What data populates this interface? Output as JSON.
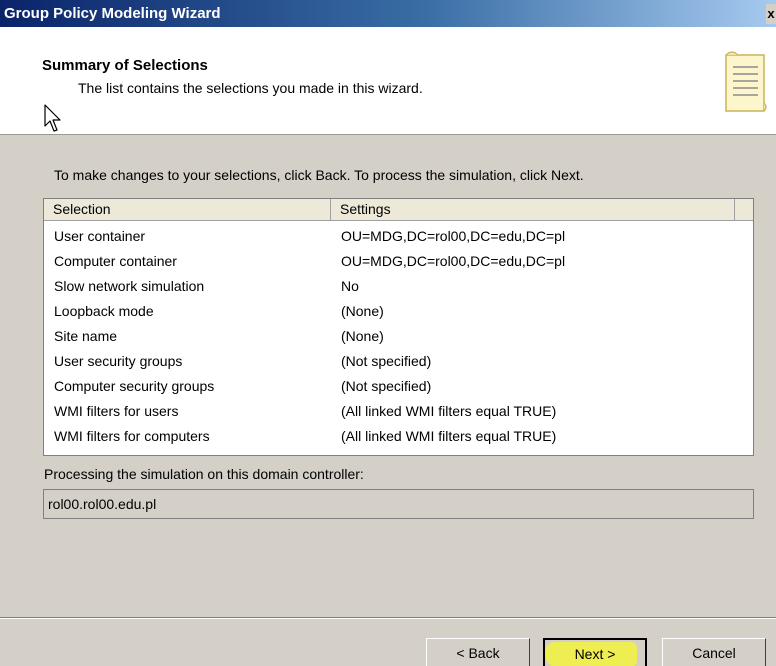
{
  "window": {
    "title": "Group Policy Modeling Wizard",
    "close_glyph": "x"
  },
  "header": {
    "title": "Summary of Selections",
    "subtitle": "The list contains the selections you made in this wizard."
  },
  "instruction": "To make changes to your selections, click Back. To process the simulation, click Next.",
  "list": {
    "columns": [
      "Selection",
      "Settings"
    ],
    "rows": [
      {
        "selection": "User container",
        "settings": "OU=MDG,DC=rol00,DC=edu,DC=pl"
      },
      {
        "selection": "Computer container",
        "settings": "OU=MDG,DC=rol00,DC=edu,DC=pl"
      },
      {
        "selection": "Slow network simulation",
        "settings": "No"
      },
      {
        "selection": "Loopback mode",
        "settings": "(None)"
      },
      {
        "selection": "Site name",
        "settings": "(None)"
      },
      {
        "selection": "User security groups",
        "settings": "(Not specified)"
      },
      {
        "selection": "Computer security groups",
        "settings": "(Not specified)"
      },
      {
        "selection": "WMI filters for users",
        "settings": "(All linked WMI filters equal TRUE)"
      },
      {
        "selection": "WMI filters for computers",
        "settings": "(All linked WMI filters equal TRUE)"
      }
    ]
  },
  "domain_controller": {
    "label": "Processing the simulation on this domain controller:",
    "value": "rol00.rol00.edu.pl"
  },
  "buttons": {
    "back": "< Back",
    "next": "Next >",
    "cancel": "Cancel"
  },
  "colors": {
    "title_bar": "#0a246a",
    "dialog_face": "#d4d0c8",
    "next_highlight": "#f2f23c"
  },
  "icons": {
    "header": "document-scroll-icon",
    "pointer": "mouse-pointer-icon"
  }
}
